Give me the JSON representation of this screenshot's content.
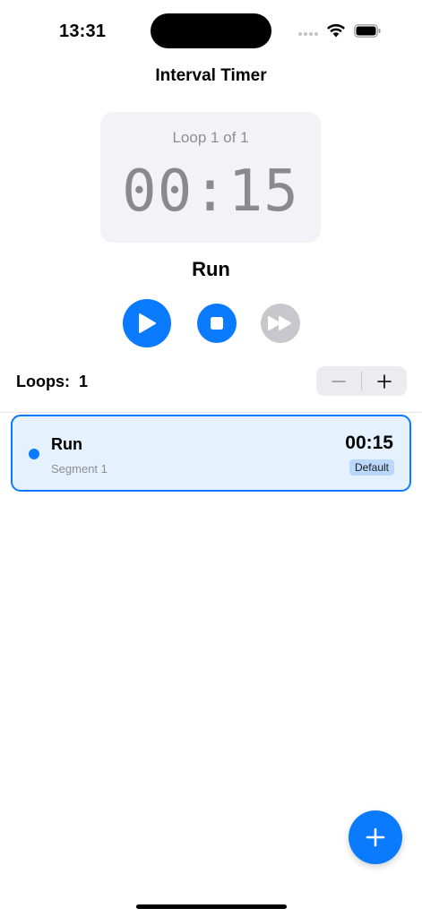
{
  "status_bar": {
    "time": "13:31"
  },
  "nav": {
    "title": "Interval Timer"
  },
  "timer": {
    "loop_label": "Loop 1 of 1",
    "display": "00:15",
    "current_segment": "Run"
  },
  "controls": {
    "play_icon": "play-icon",
    "stop_icon": "stop-icon",
    "skip_icon": "skip-forward-icon"
  },
  "loops": {
    "label": "Loops:",
    "value": "1"
  },
  "segments": [
    {
      "title": "Run",
      "subtitle": "Segment 1",
      "duration": "00:15",
      "badge": "Default"
    }
  ],
  "colors": {
    "accent": "#0a7aff",
    "disabled": "#c7c7cc",
    "card_bg": "#f2f2f7",
    "selected_row_bg": "#e6f1fe"
  }
}
